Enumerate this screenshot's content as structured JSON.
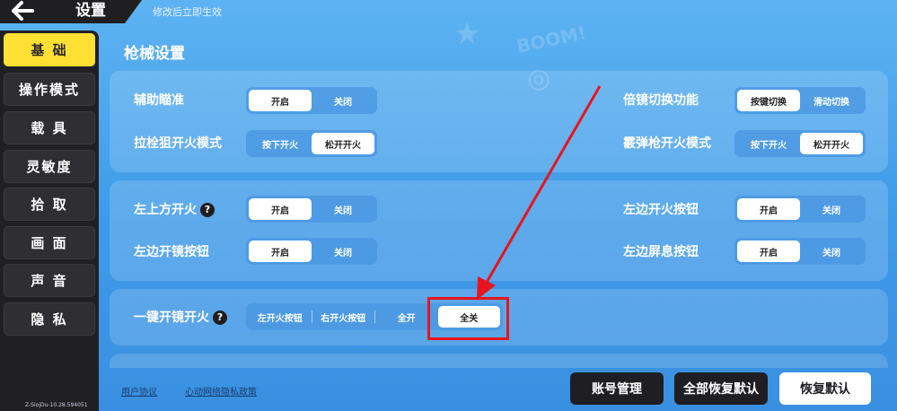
{
  "header": {
    "back_icon": "arrow-left-icon",
    "title": "设置",
    "hint": "修改后立即生效"
  },
  "sidebar": {
    "items": [
      {
        "label": "基 础",
        "active": true
      },
      {
        "label": "操作模式",
        "active": false
      },
      {
        "label": "载 具",
        "active": false
      },
      {
        "label": "灵敏度",
        "active": false
      },
      {
        "label": "拾 取",
        "active": false
      },
      {
        "label": "画 面",
        "active": false
      },
      {
        "label": "声 音",
        "active": false
      },
      {
        "label": "隐 私",
        "active": false
      }
    ],
    "version": "Z-SiojDu-10.28.594051"
  },
  "main": {
    "section_title": "枪械设置",
    "panel1": {
      "rows": [
        {
          "label": "辅助瞄准",
          "options": [
            "开启",
            "关闭"
          ],
          "selected": 0
        },
        {
          "label": "拉栓狙开火模式",
          "options": [
            "按下开火",
            "松开开火"
          ],
          "selected": 1
        },
        {
          "label": "倍镜切换功能",
          "options": [
            "按键切换",
            "滑动切换"
          ],
          "selected": 0
        },
        {
          "label": "霰弹枪开火模式",
          "options": [
            "按下开火",
            "松开开火"
          ],
          "selected": 1
        }
      ]
    },
    "panel2": {
      "rows": [
        {
          "label": "左上方开火",
          "options": [
            "开启",
            "关闭"
          ],
          "selected": 0,
          "help": "?"
        },
        {
          "label": "左边开镜按钮",
          "options": [
            "开启",
            "关闭"
          ],
          "selected": 0
        },
        {
          "label": "左边开火按钮",
          "options": [
            "开启",
            "关闭"
          ],
          "selected": 0
        },
        {
          "label": "左边屏息按钮",
          "options": [
            "开启",
            "关闭"
          ],
          "selected": 0
        }
      ]
    },
    "panel3": {
      "label": "一键开镜开火",
      "help": "?",
      "options": [
        "左开火按钮",
        "右开火按钮",
        "全开",
        "全关"
      ],
      "selected": 3
    }
  },
  "footer": {
    "user_agreement": "用户协议",
    "privacy_policy": "心动网络隐私政策",
    "account_button": "账号管理",
    "reset_all_button": "全部恢复默认",
    "reset_button": "恢复默认"
  },
  "colors": {
    "accent_yellow": "#ffe033",
    "background_blue": "#4aa6ee",
    "annotation_red": "#e8141e",
    "dark": "#1f1f23"
  }
}
